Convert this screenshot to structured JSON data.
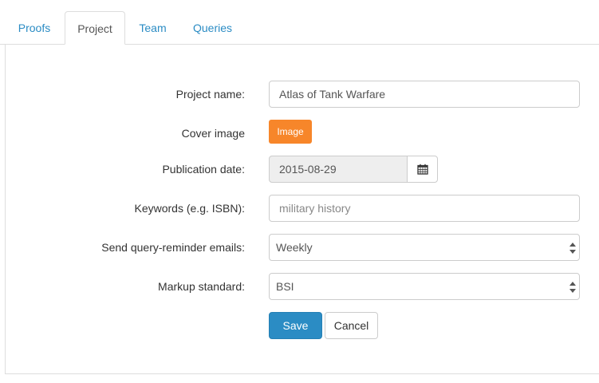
{
  "tabs": [
    {
      "label": "Proofs",
      "active": false
    },
    {
      "label": "Project",
      "active": true
    },
    {
      "label": "Team",
      "active": false
    },
    {
      "label": "Queries",
      "active": false
    }
  ],
  "form": {
    "project_name": {
      "label": "Project name:",
      "value": "Atlas of Tank Warfare"
    },
    "cover_image": {
      "label": "Cover image",
      "button_label": "Image"
    },
    "publication_date": {
      "label": "Publication date:",
      "value": "2015-08-29",
      "icon": "calendar-icon"
    },
    "keywords": {
      "label": "Keywords (e.g. ISBN):",
      "value": "military history"
    },
    "reminder_emails": {
      "label": "Send query-reminder emails:",
      "selected": "Weekly"
    },
    "markup_standard": {
      "label": "Markup standard:",
      "selected": "BSI"
    }
  },
  "actions": {
    "save_label": "Save",
    "cancel_label": "Cancel"
  },
  "colors": {
    "accent": "#2b8cc4",
    "image_button": "#f7862a"
  }
}
